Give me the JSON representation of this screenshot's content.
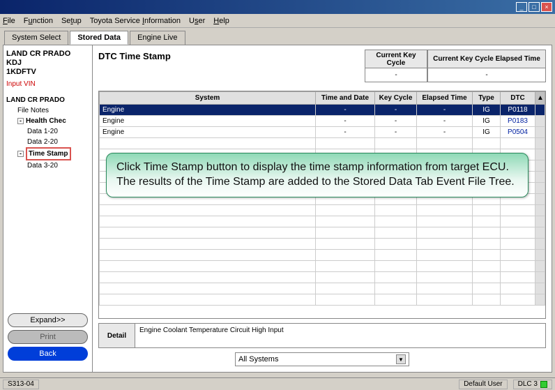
{
  "menu": {
    "items": [
      "File",
      "Function",
      "Setup",
      "Toyota Service Information",
      "User",
      "Help"
    ]
  },
  "tabs": {
    "system_select": "System Select",
    "stored_data": "Stored Data",
    "engine_live": "Engine Live"
  },
  "sidebar": {
    "vehicle_line1": "LAND CR PRADO",
    "vehicle_line2": "KDJ",
    "vehicle_line3": "1KDFTV",
    "input_vin": "Input VIN",
    "tree": {
      "root": "LAND CR PRADO",
      "file_notes": "File Notes",
      "health_check": "Health Chec",
      "data1": "Data 1-20",
      "data2": "Data 2-20",
      "time_stamp": "Time Stamp",
      "data3": "Data 3-20"
    },
    "expand_btn": "Expand>>",
    "print_btn": "Print",
    "back_btn": "Back"
  },
  "main": {
    "title": "DTC Time Stamp",
    "key_cycle_h": "Current Key Cycle",
    "key_cycle_v": "-",
    "elapsed_h": "Current Key Cycle Elapsed Time",
    "elapsed_v": "-",
    "headers": {
      "system": "System",
      "time_date": "Time and Date",
      "key_cycle": "Key Cycle",
      "elapsed": "Elapsed Time",
      "type": "Type",
      "dtc": "DTC"
    },
    "rows": [
      {
        "system": "Engine",
        "td": "-",
        "kc": "-",
        "et": "-",
        "type": "IG",
        "dtc": "P0118",
        "sel": true
      },
      {
        "system": "Engine",
        "td": "-",
        "kc": "-",
        "et": "-",
        "type": "IG",
        "dtc": "P0183",
        "sel": false
      },
      {
        "system": "Engine",
        "td": "-",
        "kc": "-",
        "et": "-",
        "type": "IG",
        "dtc": "P0504",
        "sel": false
      }
    ],
    "callout": "Click Time Stamp button to display the time stamp information from target ECU. The results of the Time Stamp are added to the Stored Data Tab Event File Tree.",
    "detail_label": "Detail",
    "detail_value": "Engine Coolant Temperature Circuit High Input",
    "filter": "All Systems"
  },
  "status": {
    "left": "S313-04",
    "user": "Default User",
    "dlc": "DLC 3"
  }
}
